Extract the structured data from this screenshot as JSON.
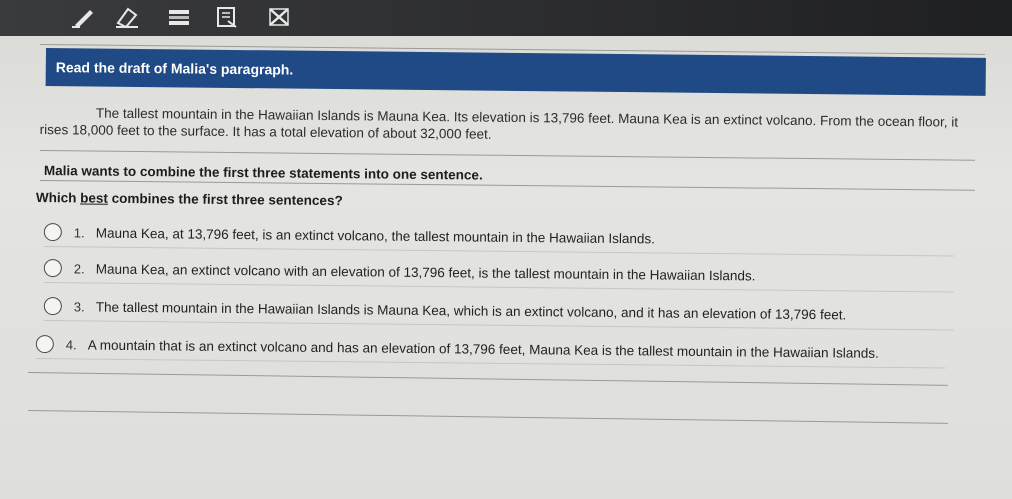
{
  "toolbar": {
    "tools": [
      "pen-icon",
      "eraser-icon",
      "highlighter-icon",
      "notepad-icon",
      "cross-out-icon"
    ]
  },
  "passage": {
    "header": "Read the draft of Malia's paragraph.",
    "text": "The tallest mountain in the Hawaiian Islands is Mauna Kea. Its elevation is 13,796 feet. Mauna Kea is an extinct volcano. From the ocean floor, it rises 18,000 feet to the surface. It has a total elevation of about 32,000 feet."
  },
  "instruction": "Malia wants to combine the first three statements into one sentence.",
  "question": {
    "before": "Which ",
    "emphasis": "best",
    "after": " combines the first three sentences?"
  },
  "choices": [
    {
      "num": "1.",
      "text": "Mauna Kea, at 13,796 feet, is an extinct volcano, the tallest mountain in the Hawaiian Islands."
    },
    {
      "num": "2.",
      "text": "Mauna Kea, an extinct volcano with an elevation of 13,796 feet, is the tallest mountain in the Hawaiian Islands."
    },
    {
      "num": "3.",
      "text": "The tallest mountain in the Hawaiian Islands is Mauna Kea, which is an extinct volcano, and it has an elevation of 13,796 feet."
    },
    {
      "num": "4.",
      "text": "A mountain that is an extinct volcano and has an elevation of 13,796 feet, Mauna Kea is the tallest mountain in the Hawaiian Islands."
    }
  ],
  "colors": {
    "header_bg": "#1f4a86",
    "toolbar_bg": "#2a2b2d"
  }
}
